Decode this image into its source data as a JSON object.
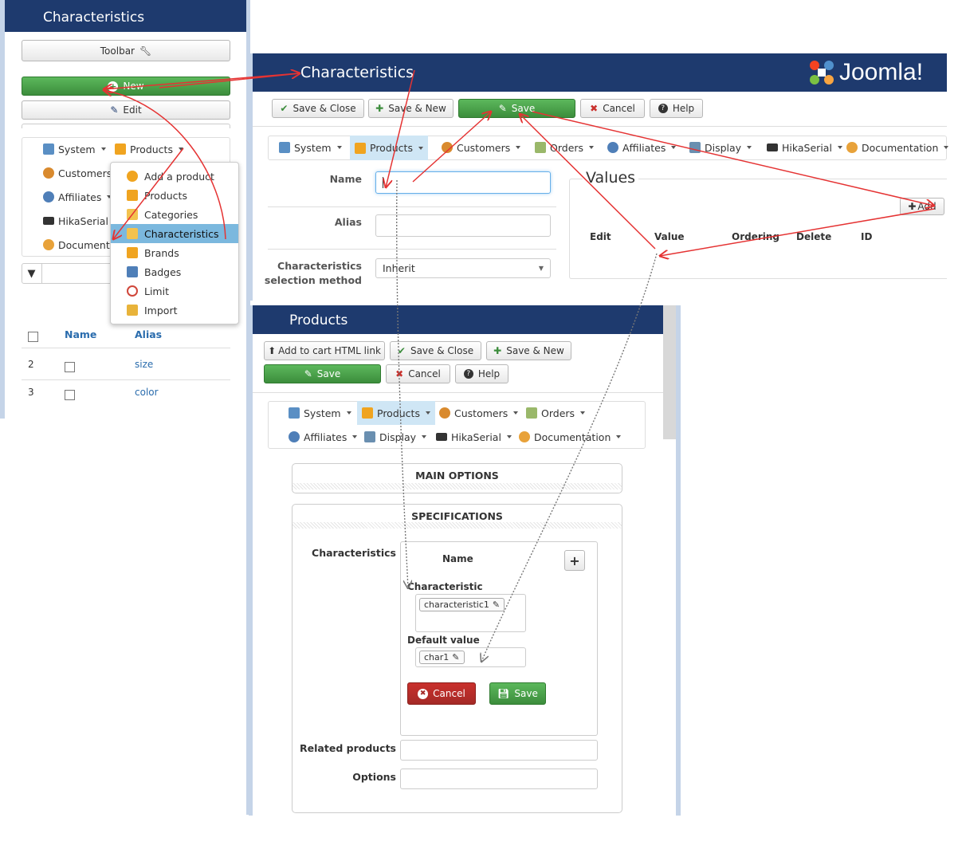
{
  "left_panel": {
    "title": "Characteristics",
    "toolbar_label": "Toolbar",
    "new_label": "New",
    "edit_label": "Edit",
    "menu": {
      "system": "System",
      "products": "Products",
      "customers": "Customers",
      "affiliates": "Affiliates",
      "hikaserial": "HikaSerial",
      "documentation": "Documenta"
    },
    "dropdown": [
      "Add a product",
      "Products",
      "Categories",
      "Characteristics",
      "Brands",
      "Badges",
      "Limit",
      "Import"
    ],
    "table": {
      "headers": [
        "Name",
        "Alias"
      ],
      "rows": [
        {
          "num": "2",
          "alias": "size"
        },
        {
          "num": "3",
          "alias": "color"
        }
      ]
    }
  },
  "char_edit": {
    "title": "Characteristics",
    "logo_text": "Joomla!",
    "buttons": [
      "Save & Close",
      "Save & New",
      "Save",
      "Cancel",
      "Help"
    ],
    "menu": [
      "System",
      "Products",
      "Customers",
      "Orders",
      "Affiliates",
      "Display",
      "HikaSerial",
      "Documentation"
    ],
    "fields": {
      "name_label": "Name",
      "alias_label": "Alias",
      "method_label": "Characteristics",
      "method_label2": "selection method",
      "method_value": "Inherit"
    },
    "values": {
      "title": "Values",
      "add_label": "Add",
      "headers": [
        "Edit",
        "Value",
        "Ordering",
        "Delete",
        "ID"
      ]
    }
  },
  "product_edit": {
    "title": "Products",
    "buttons": [
      "Add to cart HTML link",
      "Save & Close",
      "Save & New",
      "Save",
      "Cancel",
      "Help"
    ],
    "menu_row1": [
      "System",
      "Products",
      "Customers",
      "Orders"
    ],
    "menu_row2": [
      "Affiliates",
      "Display",
      "HikaSerial",
      "Documentation"
    ],
    "sections": {
      "main_options": "MAIN OPTIONS",
      "specifications": "SPECIFICATIONS"
    },
    "characteristics_label": "Characteristics",
    "name_header": "Name",
    "characteristic_label": "Characteristic",
    "characteristic_value": "characteristic1",
    "default_label": "Default value",
    "default_value": "char1",
    "cancel_label": "Cancel",
    "save_label": "Save",
    "related_label": "Related products",
    "options_label": "Options"
  },
  "colors": {
    "banner": "#1e3a6e",
    "green": "#449d44",
    "red": "#c9302c",
    "arrow": "#e53333",
    "active_menu": "#cfe6f5"
  }
}
